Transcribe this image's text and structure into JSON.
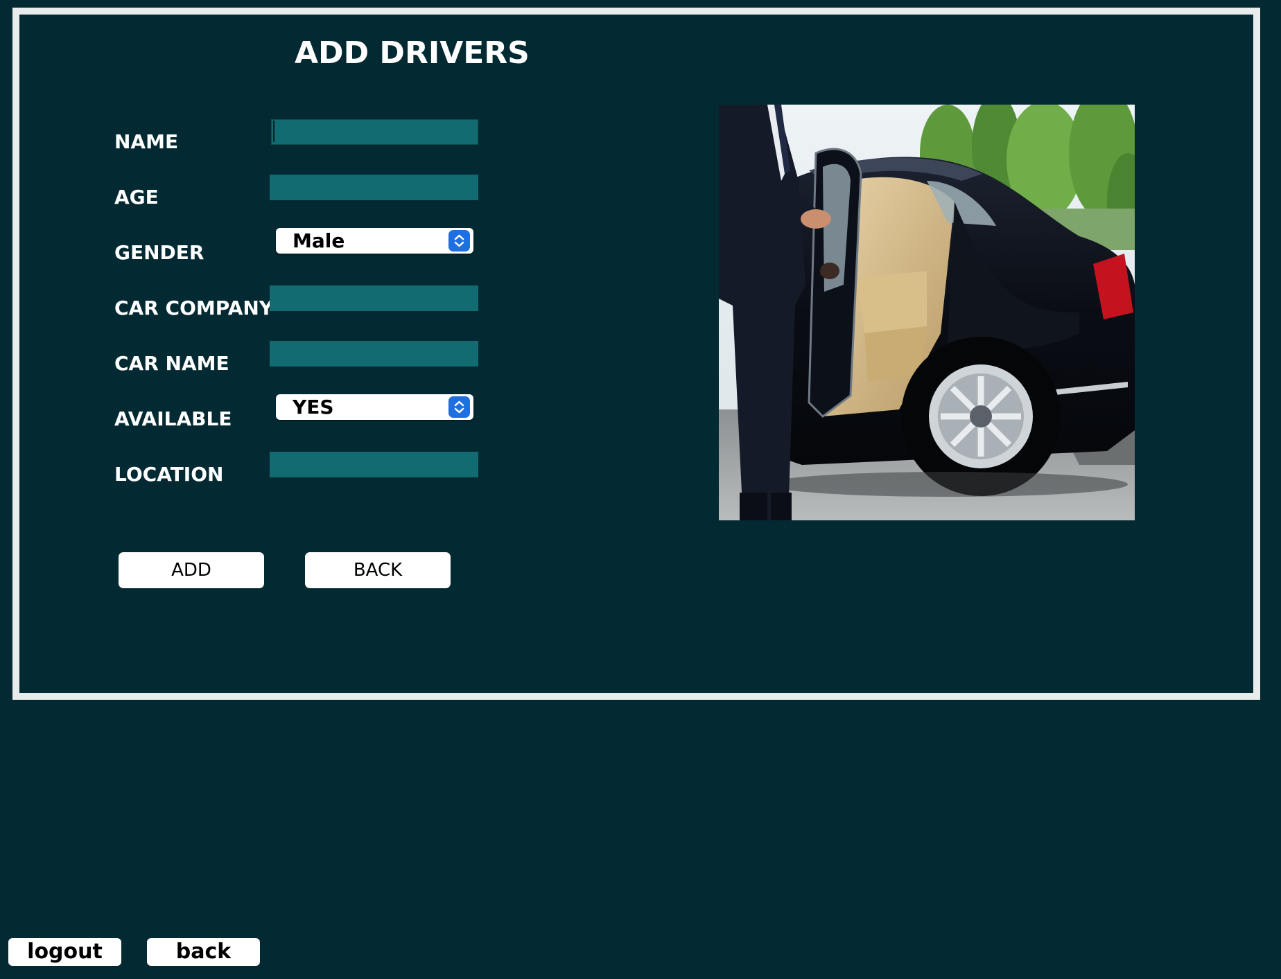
{
  "form": {
    "title": "ADD DRIVERS",
    "fields": {
      "name": {
        "label": "NAME",
        "value": ""
      },
      "age": {
        "label": "AGE",
        "value": ""
      },
      "gender": {
        "label": "GENDER",
        "selected": "Male"
      },
      "car_company": {
        "label": "CAR COMPANY",
        "value": ""
      },
      "car_name": {
        "label": "CAR NAME",
        "value": ""
      },
      "available": {
        "label": "AVAILABLE",
        "selected": "YES"
      },
      "location": {
        "label": "LOCATION",
        "value": ""
      }
    },
    "buttons": {
      "add_label": "ADD",
      "back_label": "BACK"
    }
  },
  "footer": {
    "logout_label": "logout",
    "back_label": "back"
  },
  "colors": {
    "background": "#032a32",
    "field_fill": "#126b70",
    "panel_border": "#e8ecec",
    "select_arrow": "#1f6fe0"
  },
  "icons": {
    "select_arrow": "up-down-chevron-icon",
    "photo": "chauffeur-opening-car-door-image"
  }
}
